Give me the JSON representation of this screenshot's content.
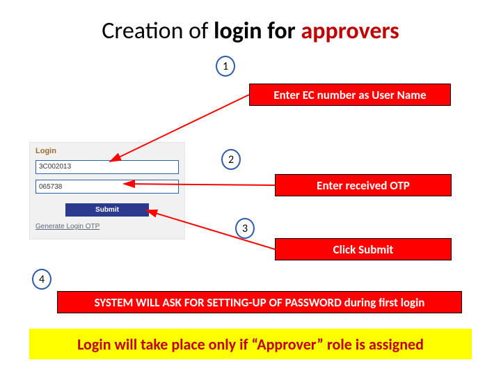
{
  "title": {
    "prefix": "Creation of ",
    "mid": "login for ",
    "highlight": "approvers"
  },
  "badges": {
    "b1": "1",
    "b2": "2",
    "b3": "3",
    "b4": "4"
  },
  "callouts": {
    "c1": "Enter EC number as User Name",
    "c2": "Enter received OTP",
    "c3": "Click Submit",
    "c4": "SYSTEM WILL ASK FOR SETTING-UP OF PASSWORD during first login"
  },
  "note": "Login will take place only if “Approver” role is assigned",
  "login": {
    "heading": "Login",
    "username": "3C002013",
    "otp": "065738",
    "submit": "Submit",
    "generate": "Generate Login OTP"
  }
}
